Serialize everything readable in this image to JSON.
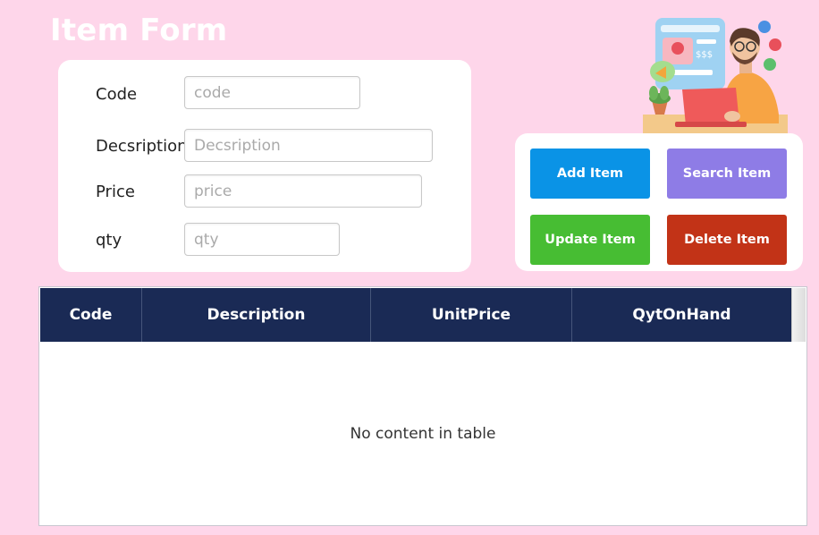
{
  "header": {
    "title": "Item Form"
  },
  "form": {
    "fields": [
      {
        "label": "Code",
        "placeholder": "code",
        "value": ""
      },
      {
        "label": "Decsription",
        "placeholder": "Decsription",
        "value": ""
      },
      {
        "label": "Price",
        "placeholder": "price",
        "value": ""
      },
      {
        "label": "qty",
        "placeholder": "qty",
        "value": ""
      }
    ]
  },
  "actions": {
    "add_label": "Add Item",
    "search_label": "Search Item",
    "update_label": "Update Item",
    "delete_label": "Delete Item"
  },
  "colors": {
    "background": "#fed6ea",
    "add": "#0a93e6",
    "search": "#8e7ce6",
    "update": "#47bd33",
    "delete": "#c23317",
    "table_header": "#1a2a55"
  },
  "illustration": {
    "price_tag": "$$$"
  },
  "table": {
    "columns": [
      "Code",
      "Description",
      "UnitPrice",
      "QytOnHand"
    ],
    "rows": [],
    "empty_message": "No content in table"
  }
}
